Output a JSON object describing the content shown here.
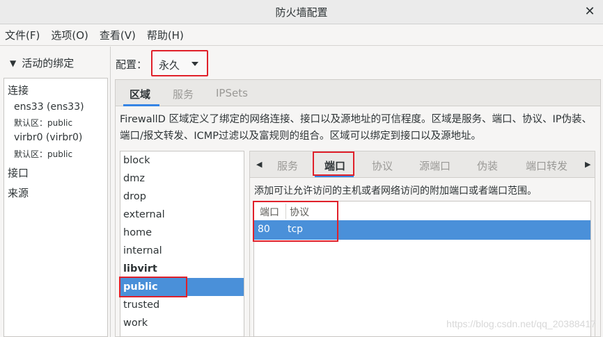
{
  "window": {
    "title": "防火墙配置"
  },
  "menu": [
    "文件(F)",
    "选项(O)",
    "查看(V)",
    "帮助(H)"
  ],
  "left": {
    "header": "活动的绑定",
    "connection_label": "连接",
    "connections": [
      {
        "name": "ens33 (ens33)",
        "zone": "默认区：public"
      },
      {
        "name": "virbr0 (virbr0)",
        "zone": "默认区：public"
      }
    ],
    "interface_label": "接口",
    "source_label": "来源"
  },
  "config": {
    "label": "配置：",
    "value": "永久"
  },
  "top_tabs": [
    "区域",
    "服务",
    "IPSets"
  ],
  "zone_description": "FirewallD 区域定义了绑定的网络连接、接口以及源地址的可信程度。区域是服务、端口、协议、IP伪装、端口/报文转发、ICMP过滤以及富规则的组合。区域可以绑定到接口以及源地址。",
  "zones": [
    "block",
    "dmz",
    "drop",
    "external",
    "home",
    "internal",
    "libvirt",
    "public",
    "trusted",
    "work"
  ],
  "sub_tabs": [
    "服务",
    "端口",
    "协议",
    "源端口",
    "伪装",
    "端口转发"
  ],
  "ports": {
    "description": "添加可让允许访问的主机或者网络访问的附加端口或者端口范围。",
    "headers": {
      "port": "端口",
      "protocol": "协议"
    },
    "rows": [
      {
        "port": "80",
        "protocol": "tcp"
      }
    ]
  },
  "watermark": "https://blog.csdn.net/qq_20388417",
  "colors": {
    "selection": "#4a90d9",
    "highlight_box": "#e0202a",
    "tab_underline": "#3584e4"
  }
}
